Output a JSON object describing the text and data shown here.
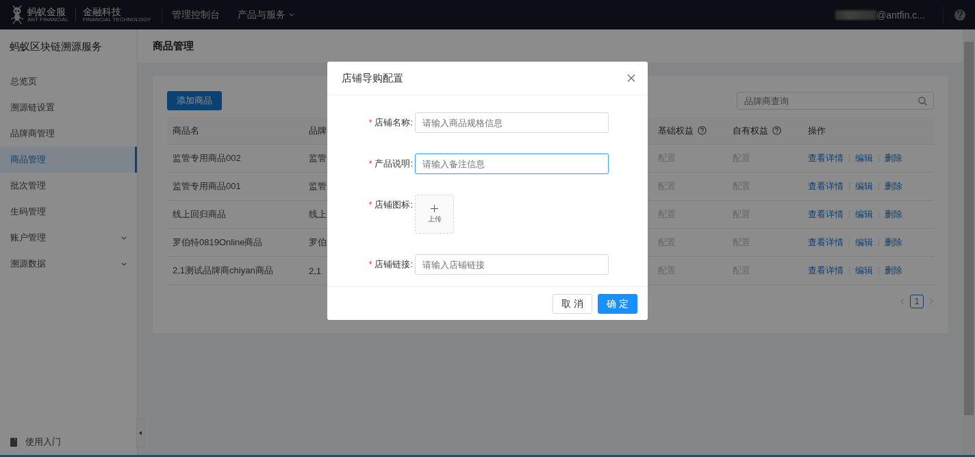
{
  "topbar": {
    "logo": {
      "name": "蚂蚁金服",
      "name_en": "ANT FINANCIAL",
      "sub": "金融科技",
      "sub_en": "FINANCIAL TECHNOLOGY"
    },
    "nav": [
      {
        "label": "管理控制台",
        "dropdown": false
      },
      {
        "label": "产品与服务",
        "dropdown": true
      }
    ],
    "user": "@antfin.c..."
  },
  "sidebar": {
    "title": "蚂蚁区块链溯源服务",
    "items": [
      {
        "label": "总览页",
        "selected": false,
        "expandable": false
      },
      {
        "label": "溯源链设置",
        "selected": false,
        "expandable": false
      },
      {
        "label": "品牌商管理",
        "selected": false,
        "expandable": false
      },
      {
        "label": "商品管理",
        "selected": true,
        "expandable": false
      },
      {
        "label": "批次管理",
        "selected": false,
        "expandable": false
      },
      {
        "label": "生码管理",
        "selected": false,
        "expandable": false
      },
      {
        "label": "账户管理",
        "selected": false,
        "expandable": true
      },
      {
        "label": "溯源数据",
        "selected": false,
        "expandable": true
      }
    ],
    "footer": "使用入门"
  },
  "page_title": "商品管理",
  "toolbar": {
    "add_button": "添加商品",
    "search": {
      "placeholder": "品牌商查询"
    }
  },
  "table": {
    "columns": [
      {
        "label": "商品名",
        "help": false
      },
      {
        "label": "品牌",
        "help": false
      },
      {
        "label": "基础权益",
        "help": true
      },
      {
        "label": "自有权益",
        "help": true
      },
      {
        "label": "操作",
        "help": false
      }
    ],
    "rows": [
      {
        "cells": [
          "监管专用商品002",
          "监管"
        ],
        "benefits": [
          "配置",
          "配置"
        ],
        "actions": [
          "查看详情",
          "编辑",
          "删除"
        ]
      },
      {
        "cells": [
          "监管专用商品001",
          "监管"
        ],
        "benefits": [
          "配置",
          "配置"
        ],
        "actions": [
          "查看详情",
          "编辑",
          "删除"
        ]
      },
      {
        "cells": [
          "线上回归商品",
          "线上"
        ],
        "benefits": [
          "配置",
          "配置"
        ],
        "actions": [
          "查看详情",
          "编辑",
          "删除"
        ]
      },
      {
        "cells": [
          "罗伯特0819Online商品",
          "罗伯"
        ],
        "benefits": [
          "配置",
          "配置"
        ],
        "actions": [
          "查看详情",
          "编辑",
          "删除"
        ]
      },
      {
        "cells": [
          "2,1测试品牌商chiyan商品",
          "2,1"
        ],
        "benefits": [
          "配置",
          "配置"
        ],
        "actions": [
          "查看详情",
          "编辑",
          "删除"
        ]
      }
    ]
  },
  "pagination": {
    "pages": [
      {
        "label": "1",
        "selected": true
      }
    ]
  },
  "modal": {
    "title": "店铺导购配置",
    "fields": [
      {
        "kind": "input",
        "label": "店铺名称:",
        "required_mark": "*",
        "placeholder": "请输入商品规格信息",
        "focused": false
      },
      {
        "kind": "input",
        "label": "产品说明:",
        "required_mark": "*",
        "placeholder": "请输入备注信息",
        "focused": true
      },
      {
        "kind": "upload",
        "label": "店铺图标:",
        "required_mark": "*",
        "upload_label": "上传"
      },
      {
        "kind": "input",
        "label": "店铺链接:",
        "required_mark": "*",
        "placeholder": "请输入店铺链接",
        "focused": false
      }
    ],
    "buttons": [
      {
        "label": "取 消",
        "kind": "default"
      },
      {
        "label": "确 定",
        "kind": "primary"
      }
    ]
  }
}
